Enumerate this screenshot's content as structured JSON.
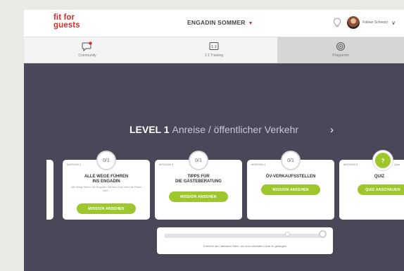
{
  "header": {
    "logo_line1": "fit for",
    "logo_line2": "guests",
    "season": "ENGADIN SOMMER",
    "season_caret": "▼",
    "user_name": "Fabian Schwarz",
    "user_caret": "∨"
  },
  "tabs": [
    {
      "label": "Community",
      "icon": "community-icon"
    },
    {
      "label": "1:1 Training",
      "icon": "training-icon"
    },
    {
      "label": "Programm",
      "icon": "programm-icon"
    }
  ],
  "level": {
    "title": "LEVEL 1",
    "subtitle": "Anreise / öffentlicher Verkehr",
    "arrow": "›"
  },
  "missions": [
    {
      "label": "MISSION 2",
      "badge": "0/1",
      "title_line1": "ALLE WEGE FÜHREN",
      "title_line2": "INS ENGADIN",
      "description": "Alle Wege führen ins Engadin: mit dem Auto über die Pässe oder...",
      "button": "MISSION ANSEHEN"
    },
    {
      "label": "MISSION 3",
      "badge": "0/1",
      "title_line1": "TIPPS FÜR",
      "title_line2": "DIE GÄSTEBERATUNG",
      "button": "MISSION ANSEHEN"
    },
    {
      "label": "MISSION 4",
      "badge": "0/1",
      "title_line1": "ÖV-VERKAUFSSTELLEN",
      "button": "MISSION ANSEHEN"
    },
    {
      "label": "MISSION 5",
      "badge": "?",
      "corner": "Quiz",
      "title_line1": "QUIZ",
      "button": "QUIZ ANSCHAUEN"
    }
  ],
  "progress": {
    "text": "Erreiche den nächsten Stern, um zum nächsten Level zu gelangen",
    "value": 0
  },
  "colors": {
    "brand_red": "#d82d2d",
    "accent_green": "#9dc72c",
    "stage": "#4a4858"
  }
}
